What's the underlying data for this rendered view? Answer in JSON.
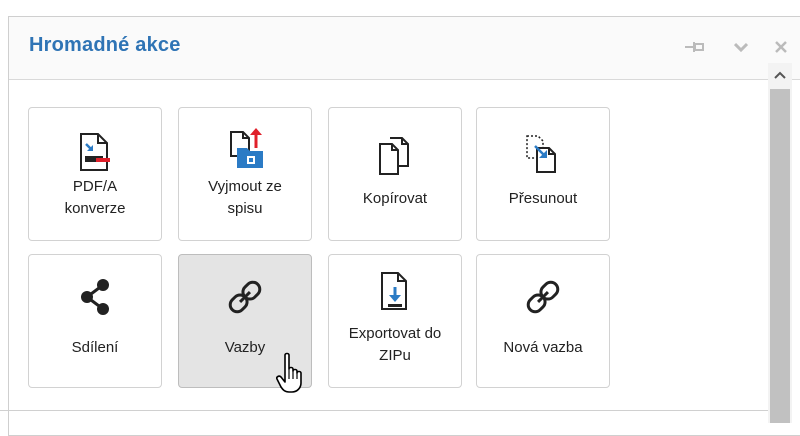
{
  "panel": {
    "title": "Hromadné akce",
    "header_icons": [
      "pin-icon",
      "chevron-down-icon",
      "close-icon"
    ]
  },
  "tiles": [
    {
      "label": "PDF/A\nkonverze",
      "icon": "pdf-convert-icon",
      "active": false
    },
    {
      "label": "Vyjmout ze\nspisu",
      "icon": "remove-from-file-icon",
      "active": false
    },
    {
      "label": "Kopírovat",
      "icon": "copy-icon",
      "active": false
    },
    {
      "label": "Přesunout",
      "icon": "move-icon",
      "active": false
    },
    {
      "label": "Sdílení",
      "icon": "share-icon",
      "active": false
    },
    {
      "label": "Vazby",
      "icon": "link-icon",
      "active": true
    },
    {
      "label": "Exportovat do\nZIPu",
      "icon": "export-zip-icon",
      "active": false
    },
    {
      "label": "Nová vazba",
      "icon": "link-icon",
      "active": false
    }
  ],
  "colors": {
    "title": "#2f74b5",
    "accent_red": "#e0202a",
    "accent_blue": "#2b7bc5",
    "active_tile_bg": "#e4e4e4"
  }
}
